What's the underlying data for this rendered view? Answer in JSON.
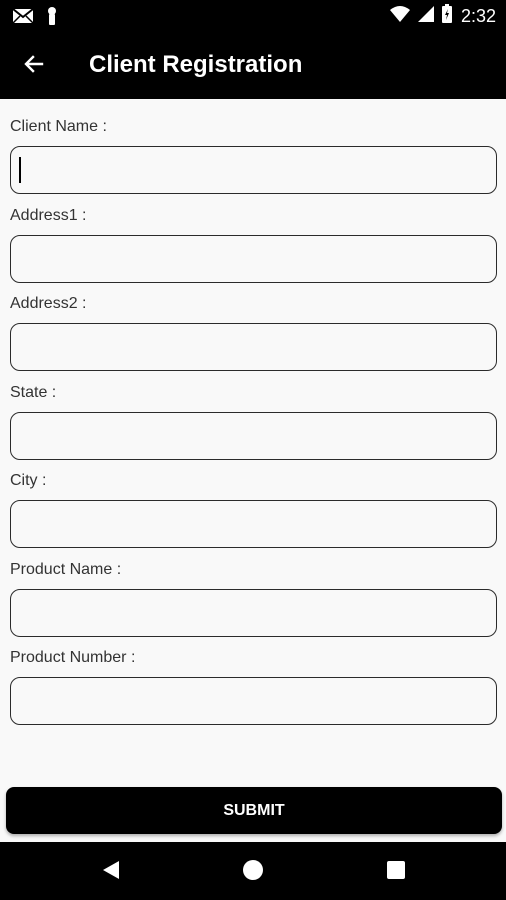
{
  "status_bar": {
    "time": "2:32",
    "icons": [
      "gmail-icon",
      "notification-icon",
      "wifi-icon",
      "signal-icon",
      "battery-icon"
    ]
  },
  "app_bar": {
    "title": "Client Registration",
    "back_icon": "arrow-left-icon"
  },
  "form": {
    "fields": [
      {
        "label": "Client Name :",
        "value": "",
        "focused": true
      },
      {
        "label": "Address1 :",
        "value": ""
      },
      {
        "label": "Address2 :",
        "value": ""
      },
      {
        "label": "State :",
        "value": ""
      },
      {
        "label": "City :",
        "value": ""
      },
      {
        "label": "Product Name :",
        "value": ""
      },
      {
        "label": "Product Number :",
        "value": ""
      }
    ],
    "submit_label": "SUBMIT"
  },
  "nav_bar": {
    "icons": [
      "back-triangle-icon",
      "home-circle-icon",
      "recents-square-icon"
    ]
  },
  "colors": {
    "bar_background": "#000000",
    "content_background": "#f9f9f9",
    "input_border": "#2b2b2b",
    "submit_background": "#000000",
    "submit_text": "#ffffff"
  }
}
